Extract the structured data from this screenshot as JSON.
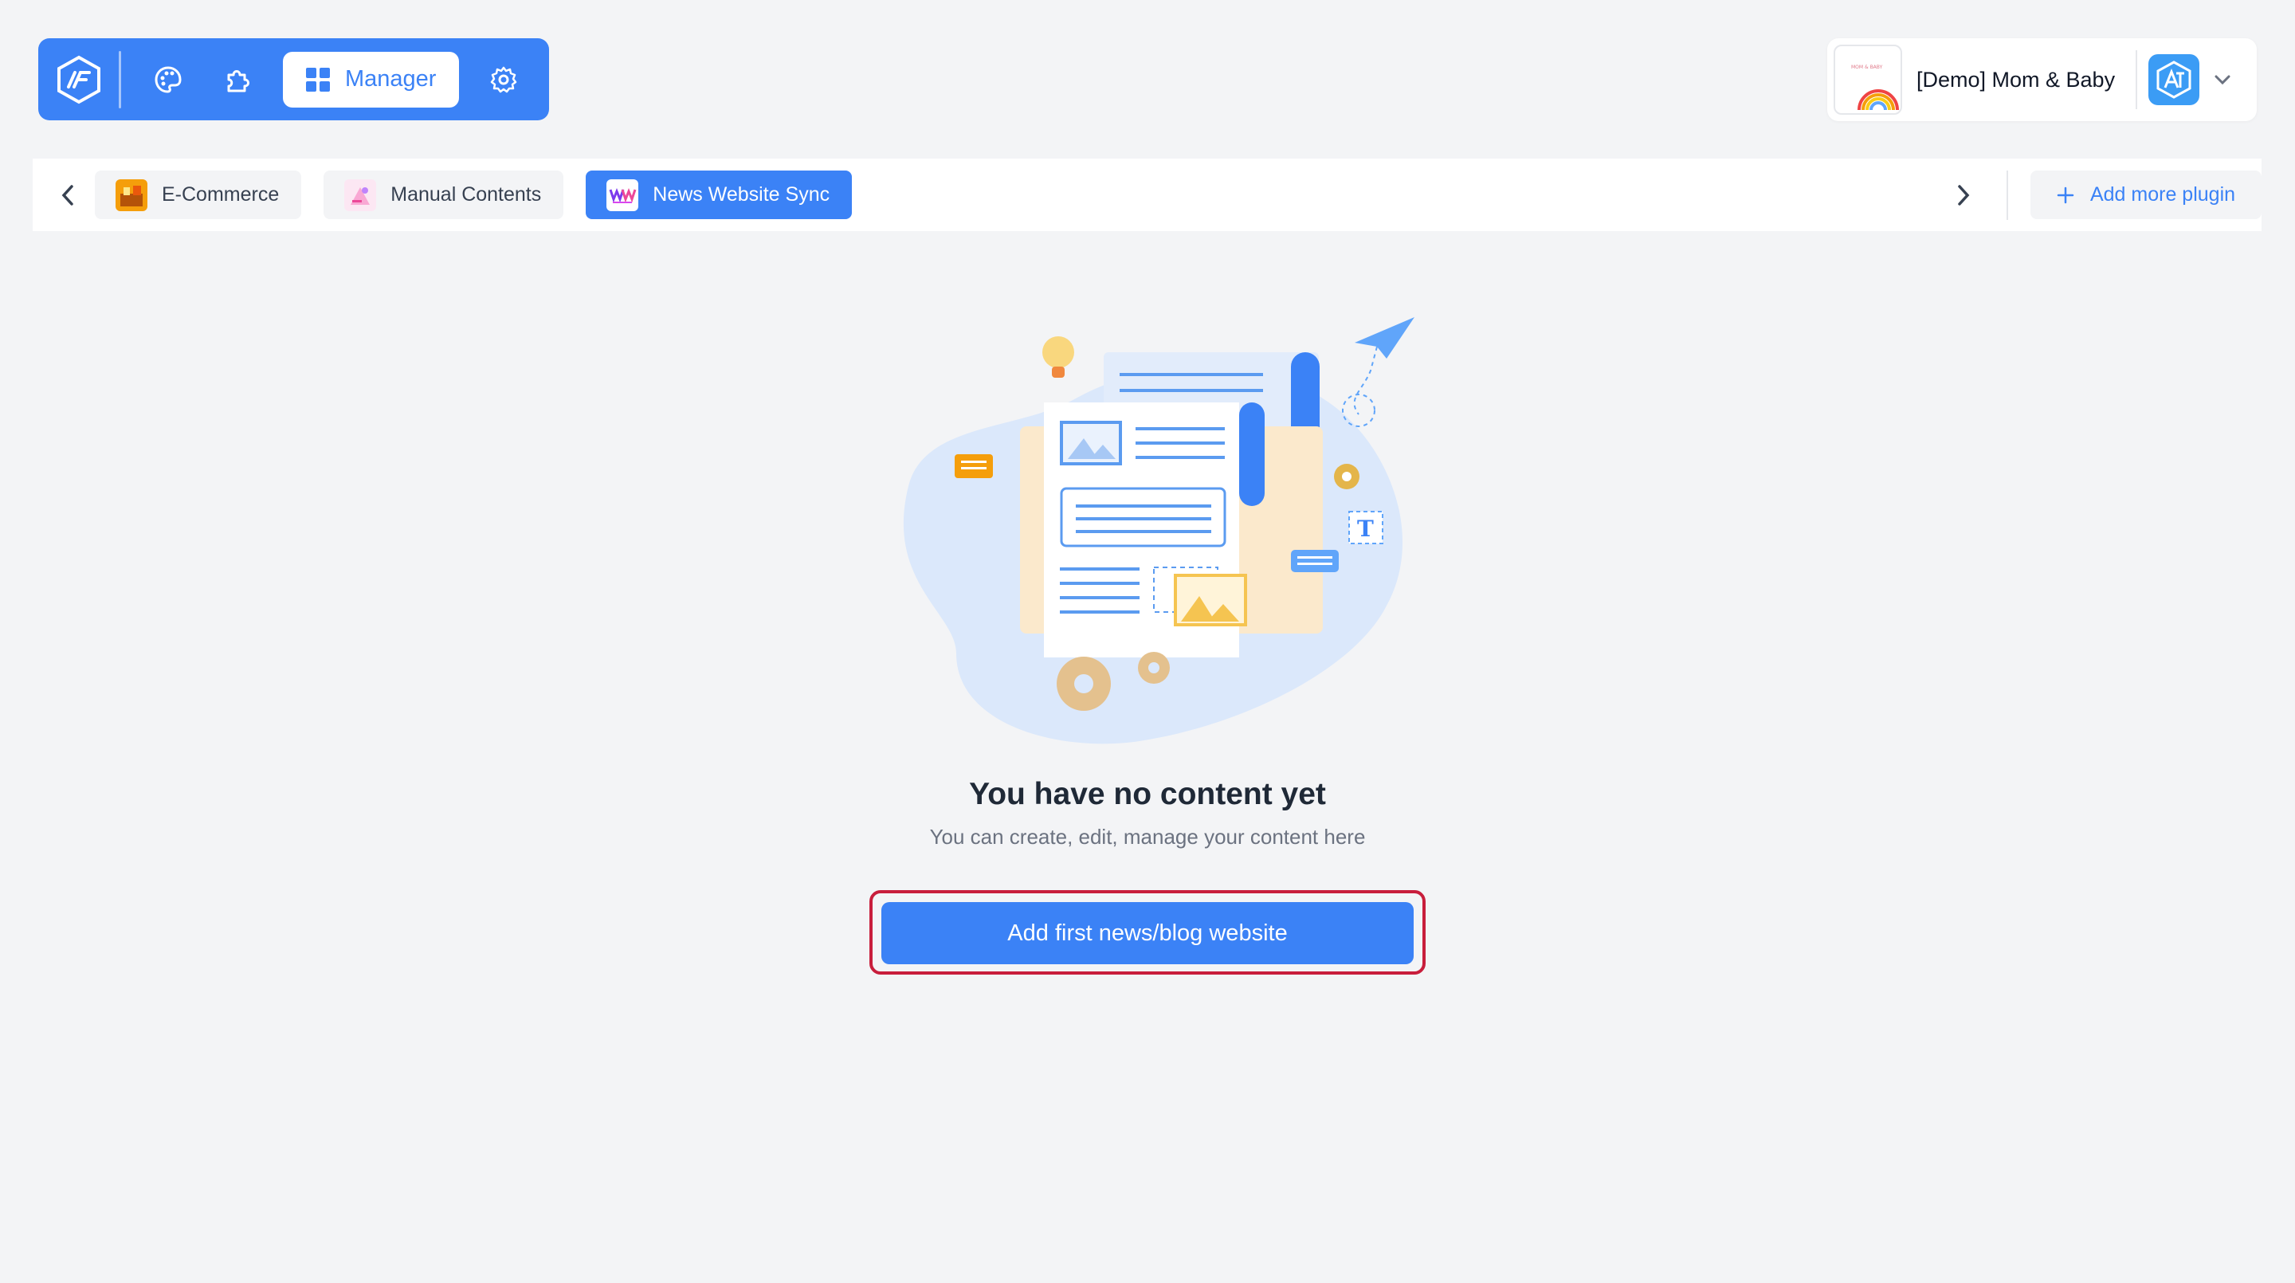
{
  "toolbar": {
    "manager_label": "Manager",
    "accent": "#3b82f6"
  },
  "account": {
    "name": "[Demo] Mom & Baby"
  },
  "tabs": [
    {
      "label": "E-Commerce",
      "active": false
    },
    {
      "label": "Manual Contents",
      "active": false
    },
    {
      "label": "News Website Sync",
      "active": true
    }
  ],
  "add_plugin_label": "Add more plugin",
  "empty_state": {
    "title": "You have no content yet",
    "subtitle": "You can create, edit, manage your content here",
    "cta_label": "Add first news/blog website"
  },
  "colors": {
    "primary": "#3b82f6",
    "highlight_outline": "#c81e3c",
    "background": "#f3f4f6"
  }
}
